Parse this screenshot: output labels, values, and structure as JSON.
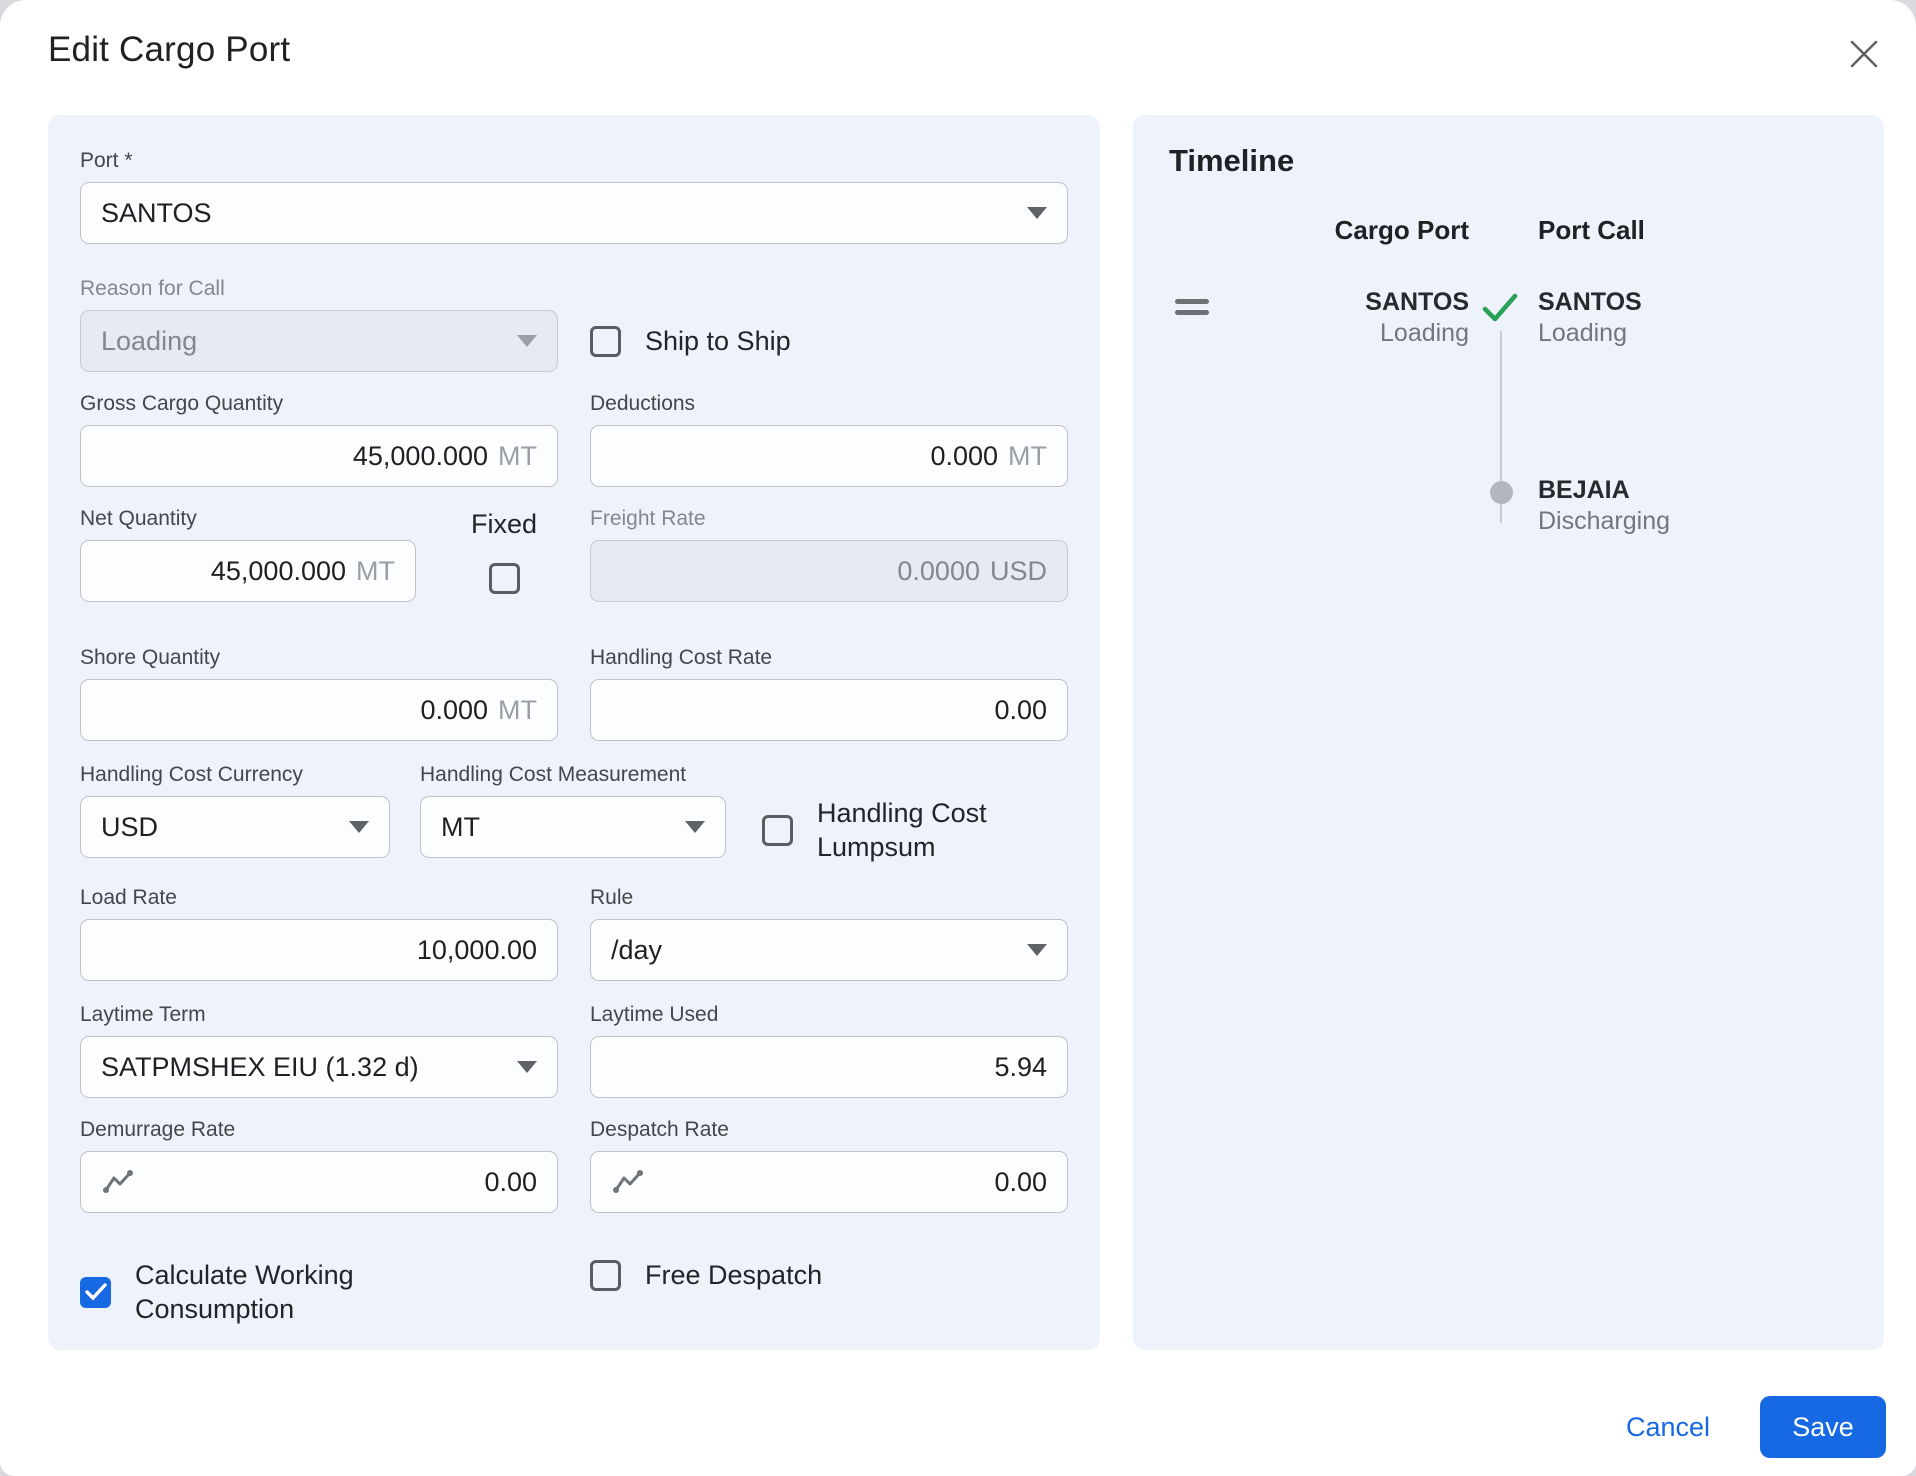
{
  "dialog": {
    "title": "Edit Cargo Port"
  },
  "form": {
    "port": {
      "label": "Port *",
      "value": "SANTOS"
    },
    "reason_for_call": {
      "label": "Reason for Call",
      "value": "Loading",
      "disabled": true
    },
    "ship_to_ship": {
      "label": "Ship to Ship",
      "checked": false
    },
    "gross_cargo_quantity": {
      "label": "Gross Cargo Quantity",
      "value": "45,000.000",
      "unit": "MT"
    },
    "deductions": {
      "label": "Deductions",
      "value": "0.000",
      "unit": "MT"
    },
    "net_quantity": {
      "label": "Net Quantity",
      "value": "45,000.000",
      "unit": "MT"
    },
    "fixed": {
      "label": "Fixed",
      "checked": false
    },
    "freight_rate": {
      "label": "Freight Rate",
      "value": "0.0000",
      "unit": "USD",
      "disabled": true
    },
    "shore_quantity": {
      "label": "Shore Quantity",
      "value": "0.000",
      "unit": "MT"
    },
    "handling_cost_rate": {
      "label": "Handling Cost Rate",
      "value": "0.00"
    },
    "handling_cost_currency": {
      "label": "Handling Cost Currency",
      "value": "USD"
    },
    "handling_cost_measurement": {
      "label": "Handling Cost Measurement",
      "value": "MT"
    },
    "handling_cost_lumpsum": {
      "label": "Handling Cost Lumpsum",
      "checked": false
    },
    "load_rate": {
      "label": "Load Rate",
      "value": "10,000.00"
    },
    "rule": {
      "label": "Rule",
      "value": "/day"
    },
    "laytime_term": {
      "label": "Laytime Term",
      "value": "SATPMSHEX EIU (1.32 d)"
    },
    "laytime_used": {
      "label": "Laytime Used",
      "value": "5.94"
    },
    "demurrage_rate": {
      "label": "Demurrage Rate",
      "value": "0.00"
    },
    "despatch_rate": {
      "label": "Despatch Rate",
      "value": "0.00"
    },
    "calculate_working_consumption": {
      "label": "Calculate Working Consumption",
      "checked": true
    },
    "free_despatch": {
      "label": "Free Despatch",
      "checked": false
    }
  },
  "timeline": {
    "title": "Timeline",
    "columns": {
      "cargo_port": "Cargo Port",
      "port_call": "Port Call"
    },
    "rows": [
      {
        "cargo_port_name": "SANTOS",
        "cargo_port_reason": "Loading",
        "port_call_name": "SANTOS",
        "port_call_reason": "Loading",
        "matched": true
      },
      {
        "port_call_name": "BEJAIA",
        "port_call_reason": "Discharging",
        "matched": false
      }
    ]
  },
  "footer": {
    "cancel_label": "Cancel",
    "save_label": "Save"
  },
  "colors": {
    "panel_bg": "#edf2fb",
    "accent_blue": "#1669e3",
    "success_green": "#2aa158",
    "disabled_bg": "#e7eaf0"
  }
}
